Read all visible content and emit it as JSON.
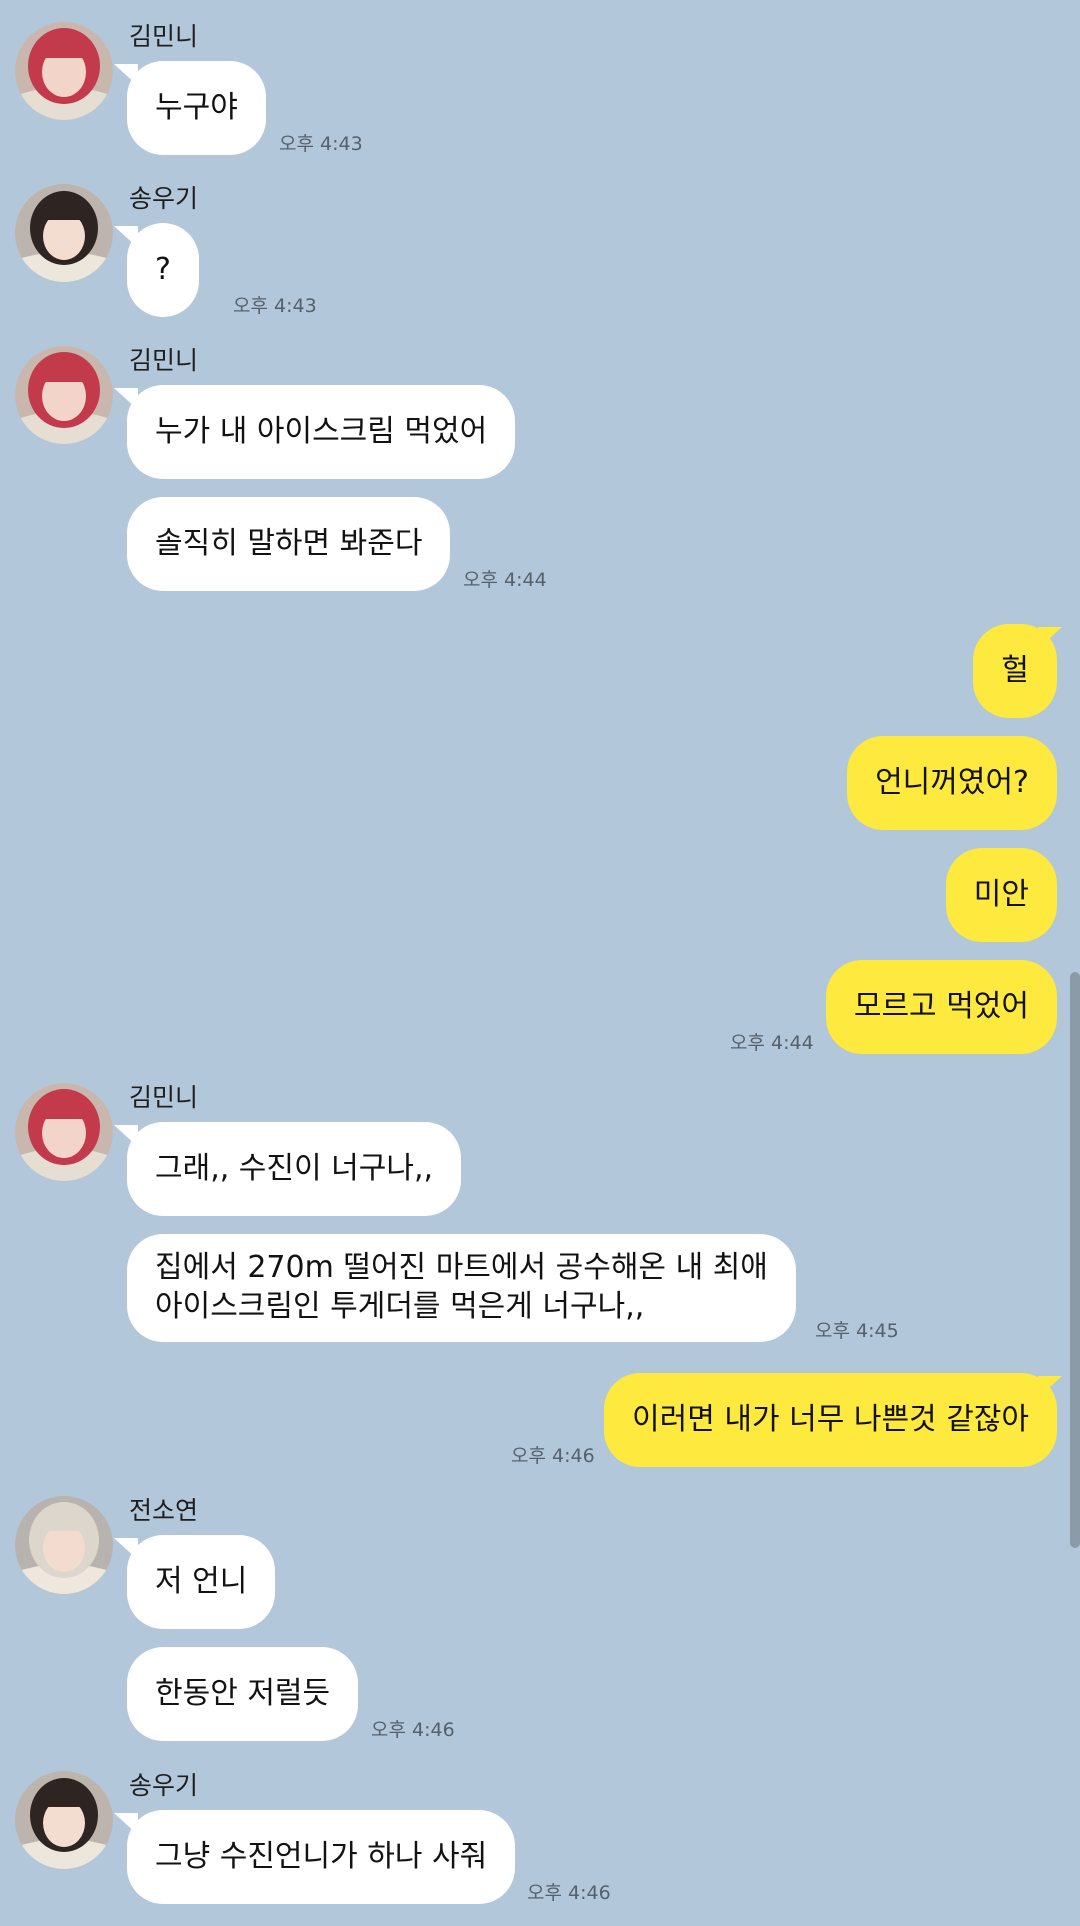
{
  "colors": {
    "background": "#b2c7da",
    "incoming_bubble": "#ffffff",
    "outgoing_bubble": "#fee93e",
    "timestamp": "#55616c"
  },
  "messages": {
    "g1": {
      "sender": "김민니",
      "avatar": "avatar-icon",
      "bubble1": "누구야",
      "time": "오후 4:43"
    },
    "g2": {
      "sender": "송우기",
      "avatar": "avatar-icon",
      "bubble1": "?",
      "time": "오후 4:43"
    },
    "g3": {
      "sender": "김민니",
      "avatar": "avatar-icon",
      "bubble1": "누가 내 아이스크림 먹었어",
      "bubble2": "솔직히 말하면 봐준다",
      "time": "오후 4:44"
    },
    "g4": {
      "sender": "me",
      "bubble1": "헐",
      "bubble2": "언니꺼였어?",
      "bubble3": "미안",
      "bubble4": "모르고 먹었어",
      "time": "오후 4:44"
    },
    "g5": {
      "sender": "김민니",
      "avatar": "avatar-icon",
      "bubble1": "그래,, 수진이 너구나,,",
      "bubble2_line1": "집에서 270m 떨어진 마트에서 공수해온 내 최애",
      "bubble2_line2": "아이스크림인 투게더를 먹은게 너구나,,",
      "time": "오후 4:45"
    },
    "g6": {
      "sender": "me",
      "bubble1": "이러면 내가 너무 나쁜것 같잖아",
      "time": "오후 4:46"
    },
    "g7": {
      "sender": "전소연",
      "avatar": "avatar-icon",
      "bubble1": "저 언니",
      "bubble2": "한동안 저럴듯",
      "time": "오후 4:46"
    },
    "g8": {
      "sender": "송우기",
      "avatar": "avatar-icon",
      "bubble1": "그냥 수진언니가 하나 사줘",
      "time": "오후 4:46"
    }
  }
}
